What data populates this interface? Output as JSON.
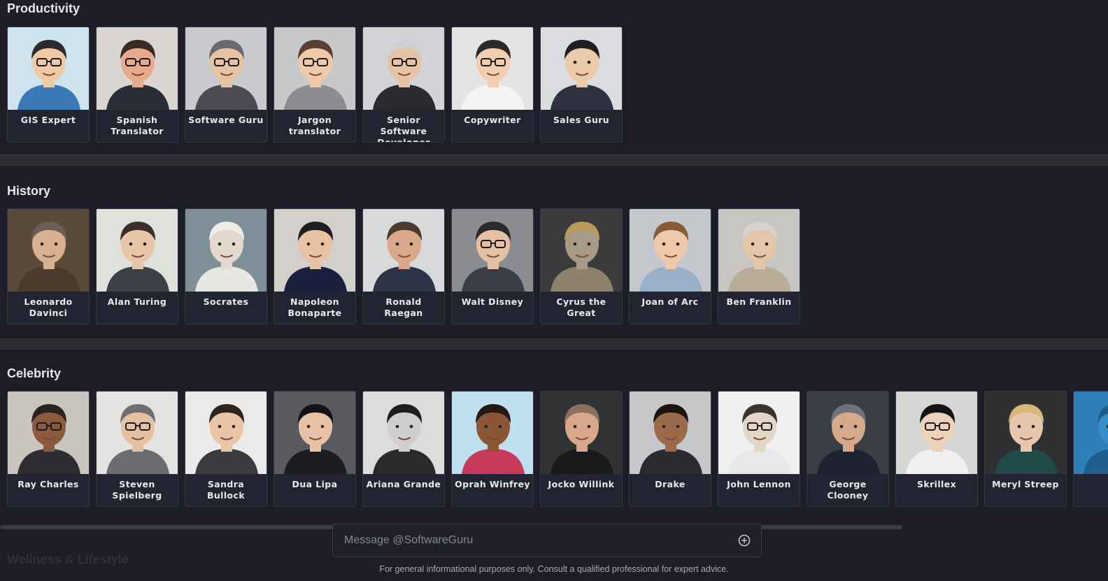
{
  "sections": [
    {
      "title": "Productivity",
      "cards": [
        {
          "label": "GIS Expert",
          "bg": "#cfe3ee",
          "skin": "#f0c9a5",
          "hair": "#2b2b2b",
          "shirt": "#3a7ab8",
          "glasses": true
        },
        {
          "label": "Spanish Translator",
          "bg": "#d9d6d2",
          "skin": "#e8a98f",
          "hair": "#3a2a22",
          "shirt": "#2b2e38",
          "glasses": true
        },
        {
          "label": "Software Guru",
          "bg": "#c9cacd",
          "skin": "#e6c3a5",
          "hair": "#6a6b70",
          "shirt": "#4a4b52",
          "glasses": true
        },
        {
          "label": "Jargon translator",
          "bg": "#c6c8ca",
          "skin": "#efc8aa",
          "hair": "#5a4034",
          "shirt": "#8c8d91",
          "glasses": true
        },
        {
          "label": "Senior Software Developer",
          "bg": "#d2d4d7",
          "skin": "#e7c3a6",
          "hair": "#cfd0d2",
          "shirt": "#2a2b30",
          "glasses": true
        },
        {
          "label": "Copywriter",
          "bg": "#e4e4e4",
          "skin": "#f2cdb0",
          "hair": "#2a2a2a",
          "shirt": "#f4f4f4",
          "glasses": true
        },
        {
          "label": "Sales Guru",
          "bg": "#dadcdf",
          "skin": "#edc9ab",
          "hair": "#1f1f22",
          "shirt": "#2d3140",
          "glasses": false
        }
      ]
    },
    {
      "title": "History",
      "cards": [
        {
          "label": "Leonardo Davinci",
          "bg": "#5a4a3a",
          "skin": "#d9b08f",
          "hair": "#6b5f52",
          "shirt": "#4a3b2c",
          "glasses": false
        },
        {
          "label": "Alan Turing",
          "bg": "#dfe2dc",
          "skin": "#e9c5a8",
          "hair": "#3b2e26",
          "shirt": "#3e4048",
          "glasses": false
        },
        {
          "label": "Socrates",
          "bg": "#7e8f98",
          "skin": "#e3d9cf",
          "hair": "#f0ece6",
          "shirt": "#e9e7e3",
          "glasses": false
        },
        {
          "label": "Napoleon Bonaparte",
          "bg": "#d3cfcb",
          "skin": "#e8c2a4",
          "hair": "#1d1d22",
          "shirt": "#1c2040",
          "glasses": false
        },
        {
          "label": "Ronald Raegan",
          "bg": "#d8d9db",
          "skin": "#d9a88a",
          "hair": "#4a3a2e",
          "shirt": "#2e3448",
          "glasses": false
        },
        {
          "label": "Walt Disney",
          "bg": "#8a8c90",
          "skin": "#e6c0a2",
          "hair": "#2a2a2c",
          "shirt": "#3a3d45",
          "glasses": true
        },
        {
          "label": "Cyrus the Great",
          "bg": "#3b3a3c",
          "skin": "#a79a86",
          "hair": "#b89a5a",
          "shirt": "#8e826e",
          "glasses": false
        },
        {
          "label": "Joan of Arc",
          "bg": "#c4c8cc",
          "skin": "#edc8aa",
          "hair": "#8a5a34",
          "shirt": "#9ab0c8",
          "glasses": false
        },
        {
          "label": "Ben Franklin",
          "bg": "#c8c6c2",
          "skin": "#e3c6aa",
          "hair": "#d6d2cb",
          "shirt": "#b9ad9a",
          "glasses": false
        }
      ]
    },
    {
      "title": "Celebrity",
      "cards": [
        {
          "label": "Ray Charles",
          "bg": "#c9c4be",
          "skin": "#8a5a3c",
          "hair": "#2a2220",
          "shirt": "#2d2d33",
          "glasses": true
        },
        {
          "label": "Steven Spielberg",
          "bg": "#e4e3e1",
          "skin": "#e6c0a2",
          "hair": "#6e6e72",
          "shirt": "#6b6c70",
          "glasses": true
        },
        {
          "label": "Sandra Bullock",
          "bg": "#ebeae8",
          "skin": "#e9c4a6",
          "hair": "#2e2420",
          "shirt": "#3a3a3f",
          "glasses": false
        },
        {
          "label": "Dua Lipa",
          "bg": "#5a5b60",
          "skin": "#e8c2a6",
          "hair": "#131317",
          "shirt": "#1d1d21",
          "glasses": false
        },
        {
          "label": "Ariana Grande",
          "bg": "#dcdcdc",
          "skin": "#cfcfcf",
          "hair": "#1e1e1e",
          "shirt": "#2a2a2a",
          "glasses": false
        },
        {
          "label": "Oprah Winfrey",
          "bg": "#bfe0ee",
          "skin": "#8a5634",
          "hair": "#231a16",
          "shirt": "#c83a5a",
          "glasses": false
        },
        {
          "label": "Jocko Willink",
          "bg": "#303234",
          "skin": "#d9a88c",
          "hair": "#8a7060",
          "shirt": "#1a1a1d",
          "glasses": false
        },
        {
          "label": "Drake",
          "bg": "#c6c7c9",
          "skin": "#9a6a4a",
          "hair": "#1a1412",
          "shirt": "#2a2b30",
          "glasses": false
        },
        {
          "label": "John Lennon",
          "bg": "#f0f0f0",
          "skin": "#e3d6c8",
          "hair": "#3a3430",
          "shirt": "#e8e8e8",
          "glasses": true
        },
        {
          "label": "George Clooney",
          "bg": "#3a3d43",
          "skin": "#d6a98a",
          "hair": "#6f7278",
          "shirt": "#1f2230",
          "glasses": false
        },
        {
          "label": "Skrillex",
          "bg": "#d6d6d4",
          "skin": "#edd2bb",
          "hair": "#141414",
          "shirt": "#f0f0f0",
          "glasses": true
        },
        {
          "label": "Meryl Streep",
          "bg": "#2f3032",
          "skin": "#e8c6ad",
          "hair": "#d8b878",
          "shirt": "#1f4a48",
          "glasses": false
        },
        {
          "label": "",
          "bg": "#2f7fb8",
          "skin": "#3a8ec8",
          "hair": "#1f5e8e",
          "shirt": "#1f5e8e",
          "glasses": false
        }
      ]
    }
  ],
  "next_section_title": "Wellness & Lifestyle",
  "composer": {
    "placeholder": "Message @SoftwareGuru",
    "plus_icon": "plus-circle-icon"
  },
  "disclaimer": "For general informational purposes only. Consult a qualified professional for expert advice."
}
